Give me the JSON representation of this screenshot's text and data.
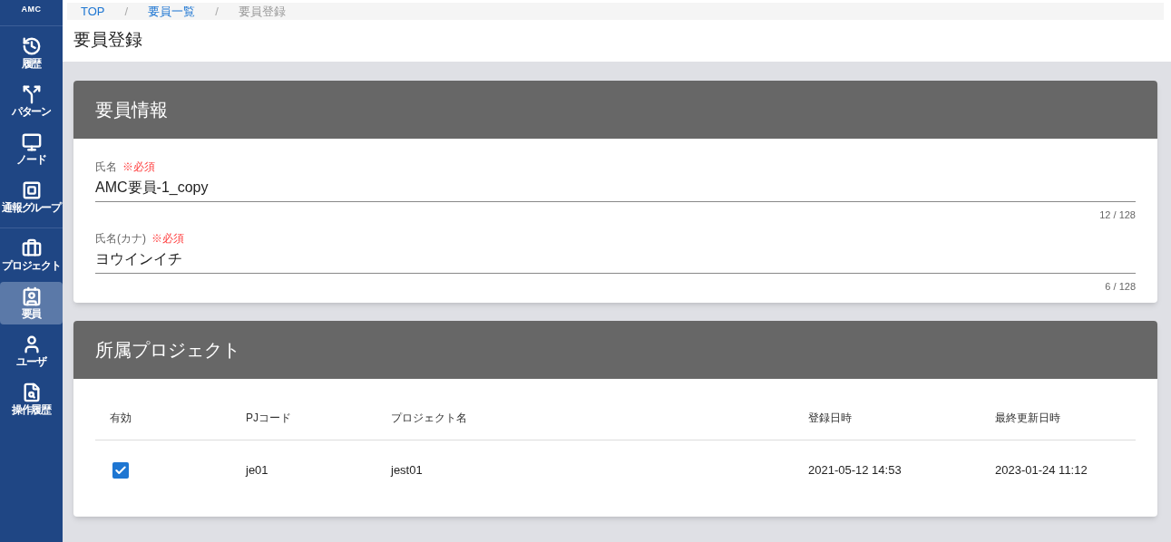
{
  "sidebar": {
    "logo": "AMC",
    "groups": [
      [
        {
          "label": "履歴",
          "selected": false
        },
        {
          "label": "パターン",
          "selected": false
        },
        {
          "label": "ノード",
          "selected": false
        },
        {
          "label": "通報グループ",
          "selected": false
        }
      ],
      [
        {
          "label": "プロジェクト",
          "selected": false
        },
        {
          "label": "要員",
          "selected": true
        },
        {
          "label": "ユーザ",
          "selected": false
        },
        {
          "label": "操作履歴",
          "selected": false
        }
      ]
    ]
  },
  "breadcrumb": [
    {
      "label": "TOP",
      "kind": "link"
    },
    {
      "label": "要員一覧",
      "kind": "link"
    },
    {
      "label": "要員登録",
      "kind": "current"
    }
  ],
  "breadcrumb_separator": "/",
  "page_title": "要員登録",
  "info_card": {
    "title": "要員情報",
    "fields": [
      {
        "label": "氏名",
        "required": "※必須",
        "value": "AMC要員-1_copy",
        "counter": "12 / 128"
      },
      {
        "label": "氏名(カナ)",
        "required": "※必須",
        "value": "ヨウインイチ",
        "counter": "6 / 128"
      }
    ]
  },
  "project_card": {
    "title": "所属プロジェクト",
    "table": {
      "checkbox_column": "有効",
      "columns": [
        "PJコード",
        "プロジェクト名",
        "登録日時",
        "最終更新日時"
      ],
      "rows": [
        {
          "checked": true,
          "cells": [
            "je01",
            "jest01",
            "2021-05-12 14:53",
            "2023-01-24 11:12"
          ]
        }
      ]
    }
  }
}
